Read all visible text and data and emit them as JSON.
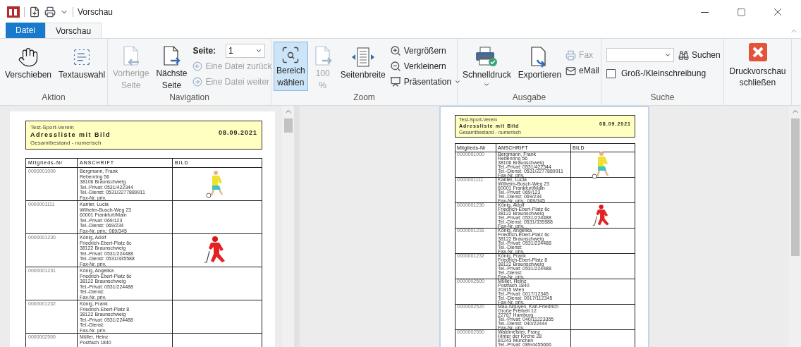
{
  "window": {
    "title": "Vorschau"
  },
  "tabs": [
    {
      "label": "Datei",
      "kind": "file",
      "selected": false
    },
    {
      "label": "Vorschau",
      "kind": "tab",
      "selected": true
    }
  ],
  "ribbon": {
    "aktion": {
      "label": "Aktion",
      "move": {
        "label": "Verschieben"
      },
      "text_select": {
        "label": "Textauswahl"
      }
    },
    "navigation": {
      "label": "Navigation",
      "previous": {
        "label": "Vorherige Seite",
        "disabled": true
      },
      "next": {
        "label": "Nächste Seite",
        "disabled": false
      },
      "page_label": "Seite:",
      "page_value": "1",
      "file_back": {
        "label": "Eine Datei zurück",
        "disabled": true
      },
      "file_forward": {
        "label": "Eine Datei weiter",
        "disabled": true
      }
    },
    "zoom": {
      "label": "Zoom",
      "select_area": {
        "label": "Bereich wählen",
        "selected": true
      },
      "hundred": {
        "label": "100 %",
        "disabled": true
      },
      "page_width": {
        "label": "Seitenbreite"
      },
      "zoom_in": {
        "label": "Vergrößern"
      },
      "zoom_out": {
        "label": "Verkleinern"
      },
      "presentation": {
        "label": "Präsentation"
      }
    },
    "ausgabe": {
      "label": "Ausgabe",
      "quick_print": {
        "label": "Schnelldruck"
      },
      "export": {
        "label": "Exportieren"
      },
      "fax": {
        "label": "Fax",
        "disabled": true
      },
      "email": {
        "label": "eMail"
      }
    },
    "suche": {
      "label": "Suche",
      "search_button": {
        "label": "Suchen"
      },
      "case_sensitive": {
        "label": "Groß-/Kleinschreibung",
        "checked": false
      }
    },
    "close": {
      "label": "Druckvorschau schließen"
    }
  },
  "pages": [
    {
      "header": {
        "club": "Test-Sport-Verein",
        "title": "Adressliste mit Bild",
        "subtitle": "Gesamtbestand - numerisch",
        "date": "08.09.2021"
      },
      "columns": [
        "Mitglieds-Nr",
        "ANSCHRIFT",
        "BILD"
      ],
      "rows": [
        {
          "number": "0000001000",
          "lines": [
            "Bergmann, Frank",
            "Rebenring 56",
            "38106 Braunschweig",
            "Tel.-Privat: 0531/422344",
            "Tel.-Dienst: 0531/2277889911",
            "Fax-Nr. priv."
          ],
          "kind": "soccer"
        },
        {
          "number": "0000001111",
          "lines": [
            "Kanter, Lucia",
            "Wilhelm-Busch-Weg 23",
            "60001 Frankfurt/Main",
            "Tel.-Privat: 069/123",
            "Tel.-Dienst: 069/234",
            "Fax-Nr. priv.: 069/345"
          ]
        },
        {
          "number": "0000001230",
          "lines": [
            "König, Adolf",
            "Friedrich-Ebert-Platz 6c",
            "38122 Braunschweig",
            "Tel.-Privat: 0531/224488",
            "Tel.-Dienst: 0531/335588",
            "Fax-Nr. priv."
          ],
          "kind": "hockey"
        },
        {
          "number": "0000001231",
          "lines": [
            "König, Angelika",
            "Friedrich-Ebert-Platz 6c",
            "38122 Braunschweig",
            "Tel.-Privat: 0531/224488",
            "Tel.-Dienst:",
            "Fax-Nr. priv."
          ]
        },
        {
          "number": "0000001232",
          "lines": [
            "König, Frank",
            "Friedrich-Ebert-Platz 8",
            "38122 Braunschweig",
            "Tel.-Privat: 0531/224488",
            "Tel.-Dienst:",
            "Fax-Nr. priv."
          ]
        },
        {
          "number": "0000002500",
          "lines": [
            "Müller, Heinz",
            "Postfach 1840"
          ]
        }
      ]
    },
    {
      "header": {
        "club": "Test-Sport-Verein",
        "title": "Adressliste mit Bild",
        "subtitle": "Gesamtbestand - numerisch",
        "date": "08.09.2021"
      },
      "columns": [
        "Mitglieds-Nr",
        "ANSCHRIFT",
        "BILD"
      ],
      "rows": [
        {
          "number": "0000001000",
          "lines": [
            "Bergmann, Frank",
            "Rebenring 56",
            "38106 Braunschweig",
            "Tel.-Privat: 0531/422344",
            "Tel.-Dienst: 0531/2277889911",
            "Fax-Nr. priv."
          ],
          "kind": "soccer"
        },
        {
          "number": "0000001111",
          "lines": [
            "Kanter, Lucia",
            "Wilhelm-Busch-Weg 23",
            "60001 Frankfurt/Main",
            "Tel.-Privat: 069/123",
            "Tel.-Dienst: 069/234",
            "Fax-Nr. priv.: 069/345"
          ]
        },
        {
          "number": "0000001230",
          "lines": [
            "König, Adolf",
            "Friedrich-Ebert-Platz 6c",
            "38122 Braunschweig",
            "Tel.-Privat: 0531/224488",
            "Tel.-Dienst: 0531/335588",
            "Fax-Nr. priv."
          ],
          "kind": "hockey"
        },
        {
          "number": "0000001231",
          "lines": [
            "König, Angelika",
            "Friedrich-Ebert-Platz 6c",
            "38122 Braunschweig",
            "Tel.-Privat: 0531/224488",
            "Tel.-Dienst:",
            "Fax-Nr. priv."
          ]
        },
        {
          "number": "0000001232",
          "lines": [
            "König, Frank",
            "Friedrich-Ebert-Platz 8",
            "38122 Braunschweig",
            "Tel.-Privat: 0531/224488",
            "Tel.-Dienst:",
            "Fax-Nr. priv."
          ]
        },
        {
          "number": "0000002500",
          "lines": [
            "Müller, Heinz",
            "Postfach 1840",
            "20315 Wien",
            "Tel.-Privat: 0017/12345",
            "Tel.-Dienst: 0017/112345",
            "Fax-Nr. priv."
          ]
        },
        {
          "number": "0000002520",
          "lines": [
            "Mau-Nguyen, Karl-Friedrich",
            "Große Freiheit 12",
            "22767 Hamburg",
            "Tel.-Privat: 040/11223355",
            "Tel.-Dienst: 040/22444",
            "Fax-Nr. priv."
          ]
        },
        {
          "number": "0000002550",
          "lines": [
            "Waldmeister, Franz",
            "Hinter der Kirche 28",
            "81243 München",
            "Tel.-Privat: 089/4455666"
          ]
        }
      ]
    }
  ]
}
